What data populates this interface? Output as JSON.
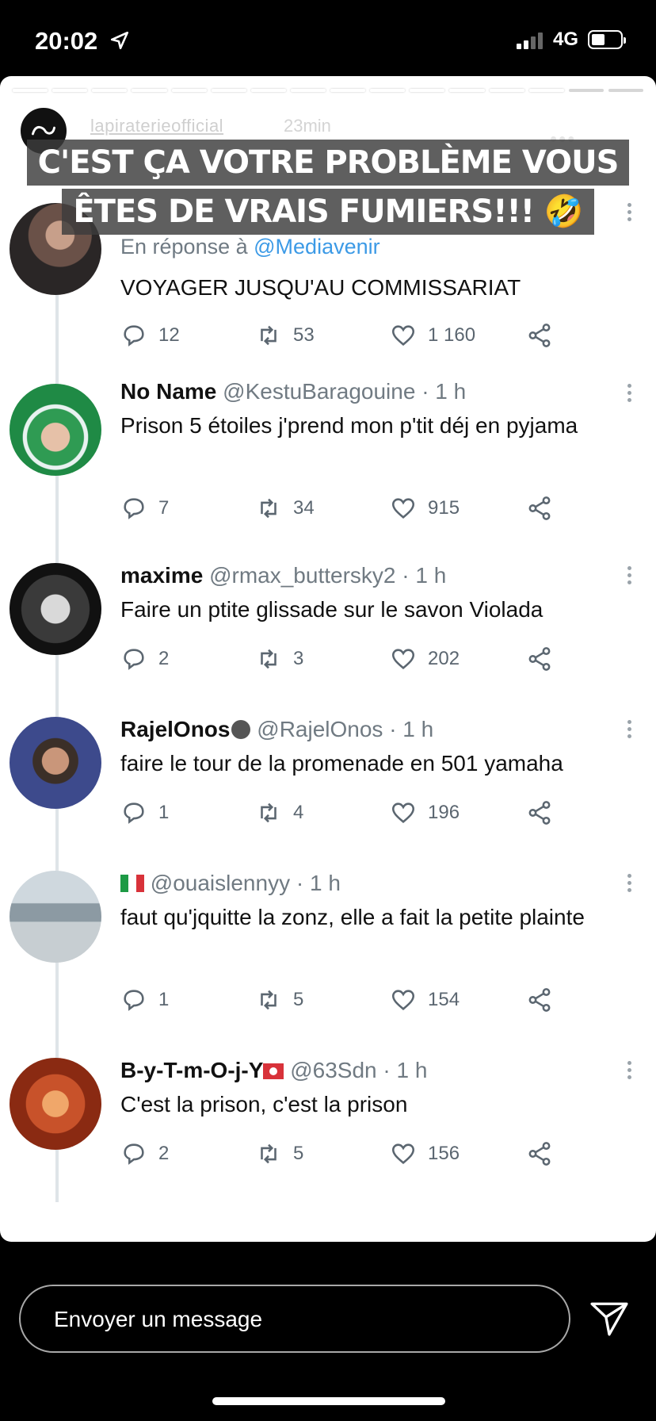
{
  "status": {
    "time": "20:02",
    "network": "4G"
  },
  "story": {
    "username": "lapiraterieofficial",
    "time_ago": "23min",
    "caption_lines": [
      "C'EST ÇA VOTRE PROBLÈME VOUS",
      "ÊTES DE VRAIS FUMIERS!!! 🤣"
    ]
  },
  "tweets": [
    {
      "reply_prefix": "En réponse à",
      "reply_handle": "@Mediavenir",
      "text": "VOYAGER JUSQU'AU COMMISSARIAT",
      "replies": "12",
      "retweets": "53",
      "likes": "1 160"
    },
    {
      "name": "No Name",
      "handle": "@KestuBaragouine",
      "time": "· 1 h",
      "text": "Prison 5 étoiles j'prend mon p'tit déj en pyjama",
      "replies": "7",
      "retweets": "34",
      "likes": "915"
    },
    {
      "name": "maxime",
      "handle": "@rmax_buttersky2",
      "time": "· 1 h",
      "text": "Faire un ptite glissade sur le savon Violada",
      "replies": "2",
      "retweets": "3",
      "likes": "202"
    },
    {
      "name": "RajelOnos",
      "handle": "@RajelOnos",
      "time": "· 1 h",
      "text": "faire le tour de la promenade en 501 yamaha",
      "replies": "1",
      "retweets": "4",
      "likes": "196"
    },
    {
      "name": "🇮🇹",
      "handle": "@ouaislennyy",
      "time": "· 1 h",
      "text": "faut qu'jquitte la zonz, elle a fait la petite plainte",
      "replies": "1",
      "retweets": "5",
      "likes": "154"
    },
    {
      "name": "B-y-T-m-O-j-Y",
      "handle": "@63Sdn",
      "time": "· 1 h",
      "text": "C'est la prison, c'est la prison",
      "replies": "2",
      "retweets": "5",
      "likes": "156"
    }
  ],
  "message_bar": {
    "placeholder": "Envoyer un message"
  },
  "colors": {
    "background": "#000000",
    "handle": "#707a82",
    "link": "#3c9ae6",
    "icon": "#5b6670"
  }
}
